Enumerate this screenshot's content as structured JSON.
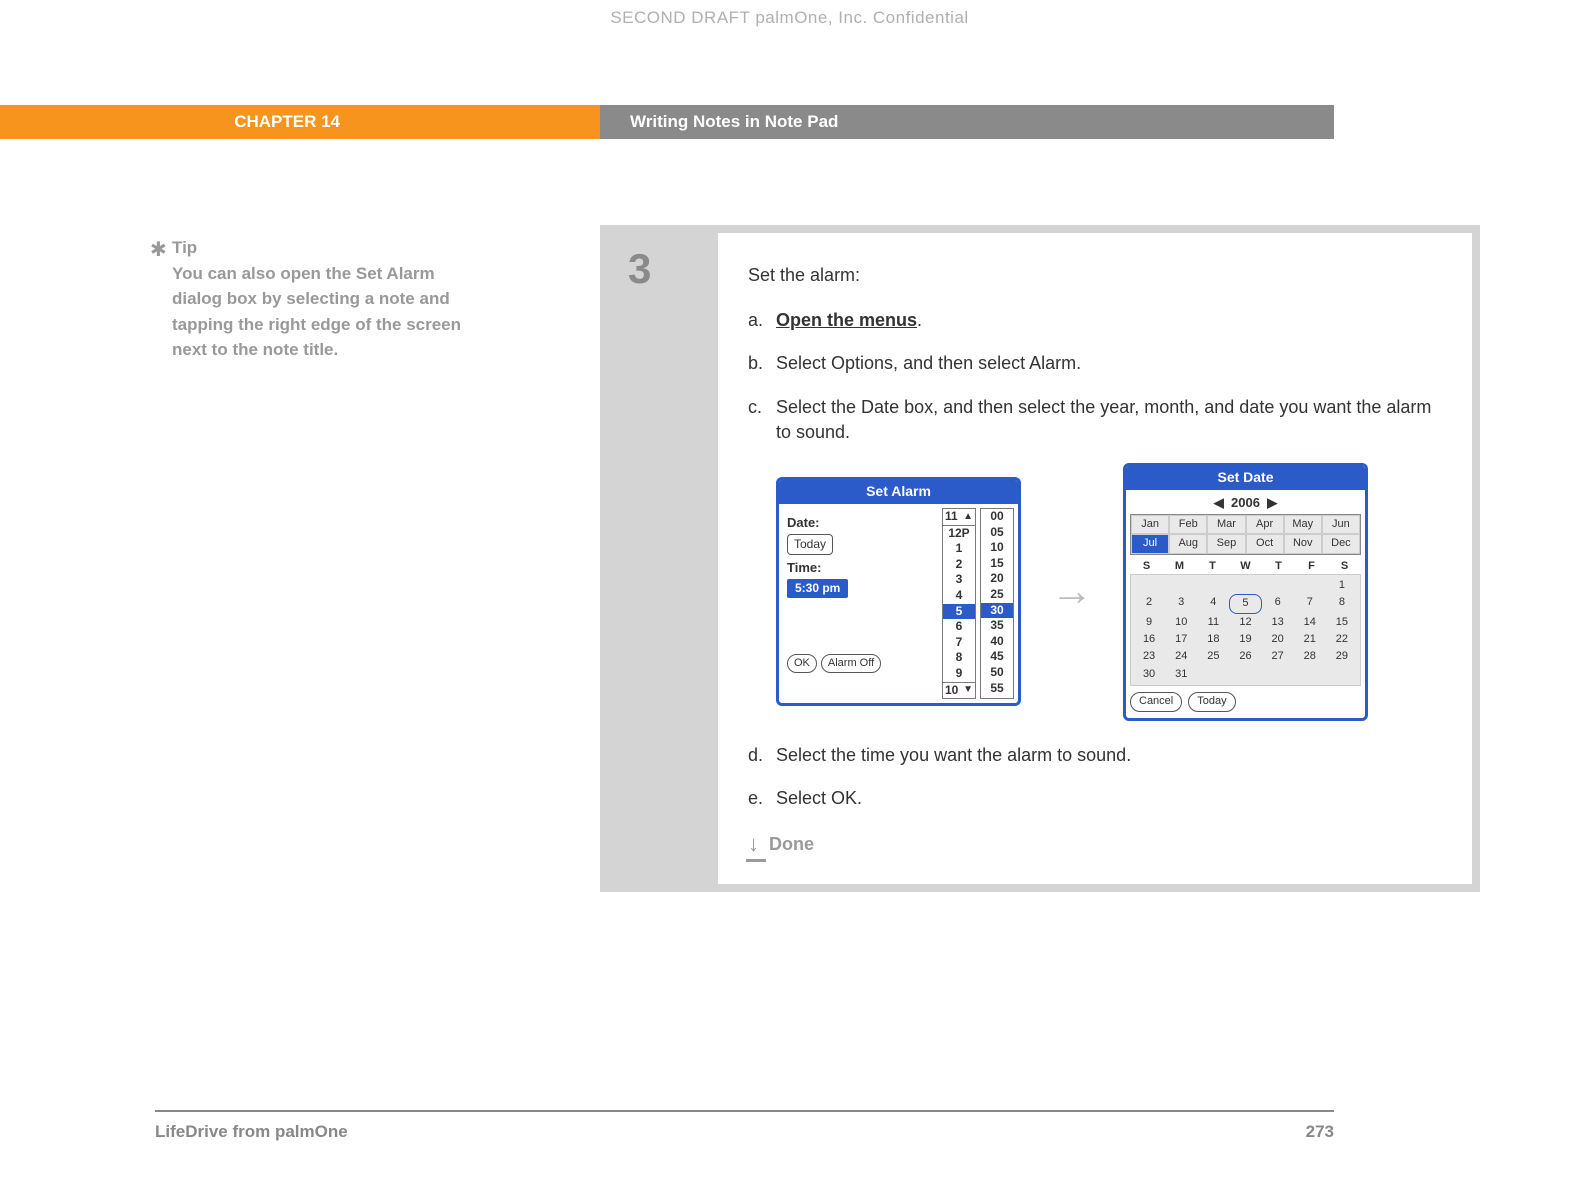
{
  "watermark": "SECOND DRAFT palmOne, Inc.  Confidential",
  "header": {
    "chapter": "CHAPTER 14",
    "title": "Writing Notes in Note Pad"
  },
  "tip": {
    "label": "Tip",
    "body": "You can also open the Set Alarm dialog box by selecting a note and tapping the right edge of the screen next to the note title."
  },
  "step": {
    "number": "3",
    "intro": "Set the alarm:",
    "items": {
      "a": {
        "letter": "a.",
        "prefix": "",
        "link": "Open the menus",
        "suffix": "."
      },
      "b": {
        "letter": "b.",
        "text": "Select Options, and then select Alarm."
      },
      "c": {
        "letter": "c.",
        "text": "Select the Date box, and then select the year, month, and date you want the alarm to sound."
      },
      "d": {
        "letter": "d.",
        "text": "Select the time you want the alarm to sound."
      },
      "e": {
        "letter": "e.",
        "text": "Select OK."
      }
    },
    "done": "Done"
  },
  "set_alarm": {
    "title": "Set Alarm",
    "date_label": "Date:",
    "date_value": "Today",
    "time_label": "Time:",
    "time_value": "5:30 pm",
    "ok": "OK",
    "alarm_off": "Alarm Off",
    "hours_top": "11",
    "hours": [
      "12P",
      "1",
      "2",
      "3",
      "4",
      "5",
      "6",
      "7",
      "8",
      "9"
    ],
    "hours_bottom": "10",
    "hour_selected": "5",
    "minutes": [
      "00",
      "05",
      "10",
      "15",
      "20",
      "25",
      "30",
      "35",
      "40",
      "45",
      "50",
      "55"
    ],
    "minute_selected": "30"
  },
  "set_date": {
    "title": "Set Date",
    "year": "2006",
    "months_row1": [
      "Jan",
      "Feb",
      "Mar",
      "Apr",
      "May",
      "Jun"
    ],
    "months_row2": [
      "Jul",
      "Aug",
      "Sep",
      "Oct",
      "Nov",
      "Dec"
    ],
    "month_selected": "Jul",
    "dow": [
      "S",
      "M",
      "T",
      "W",
      "T",
      "F",
      "S"
    ],
    "days": [
      [
        "",
        "",
        "",
        "",
        "",
        "",
        "1"
      ],
      [
        "2",
        "3",
        "4",
        "5",
        "6",
        "7",
        "8"
      ],
      [
        "9",
        "10",
        "11",
        "12",
        "13",
        "14",
        "15"
      ],
      [
        "16",
        "17",
        "18",
        "19",
        "20",
        "21",
        "22"
      ],
      [
        "23",
        "24",
        "25",
        "26",
        "27",
        "28",
        "29"
      ],
      [
        "30",
        "31",
        "",
        "",
        "",
        "",
        ""
      ]
    ],
    "day_selected": "5",
    "cancel": "Cancel",
    "today": "Today"
  },
  "footer": {
    "product": "LifeDrive from palmOne",
    "page": "273"
  }
}
